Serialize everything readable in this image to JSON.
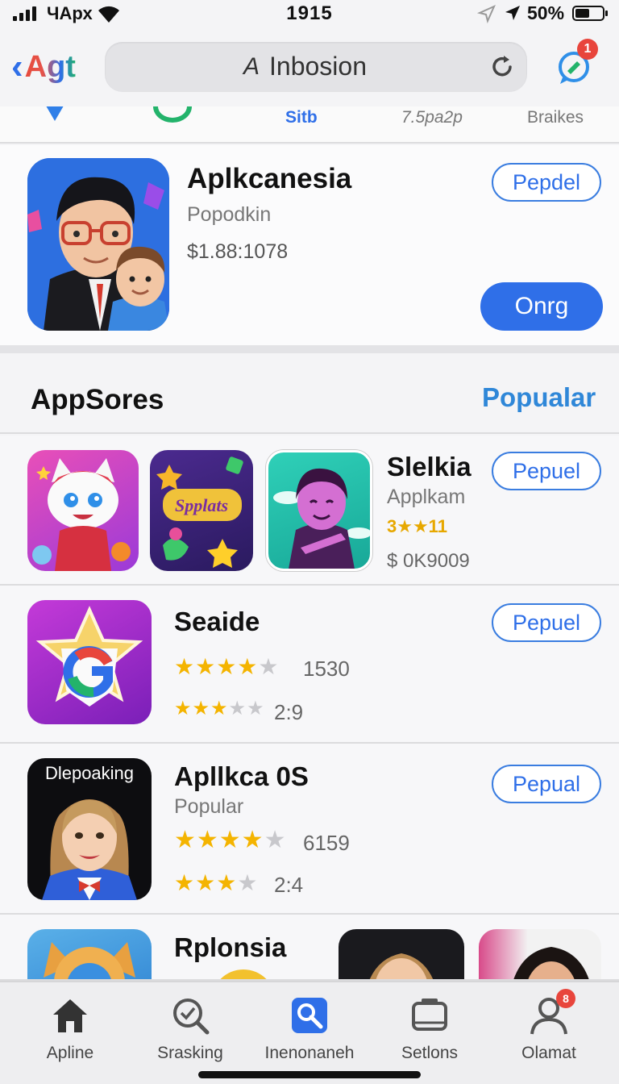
{
  "status_bar": {
    "carrier": "ЧАрх",
    "time": "1915",
    "battery": "50%"
  },
  "nav": {
    "brand": "Agt",
    "search_text": "Inbosion",
    "search_icon": "A",
    "notification_count": "1"
  },
  "categories": [
    "Sitb",
    "7.5pa2p",
    "Braikes"
  ],
  "featured": {
    "title": "Aplkcanesia",
    "subtitle": "Popodkin",
    "price": "$1.88:1078",
    "button_outline": "Pepdel",
    "button_primary": "Onrg"
  },
  "section": {
    "title": "AppSores",
    "link": "Popualar"
  },
  "rows": [
    {
      "title": "Slelkia",
      "subtitle": "Applkam",
      "rating_text": "3★★11",
      "price": "$ 0K9009",
      "button": "Pepuel"
    },
    {
      "title": "Seaide",
      "rating1": {
        "stars": 4.5,
        "count": "1530"
      },
      "rating2": {
        "stars": 2.5,
        "count": "2:9"
      },
      "button": "Pepuel"
    },
    {
      "title": "Apllkca 0S",
      "subtitle": "Popular",
      "tile_label": "Dlepoaking",
      "rating1": {
        "stars": 4,
        "count": "6159"
      },
      "rating2": {
        "stars": 3,
        "count": "2:4"
      },
      "button": "Pepual"
    },
    {
      "title": "Rplonsia"
    }
  ],
  "tile_text": {
    "splats": "Spplats"
  },
  "tabs": [
    {
      "label": "Apline",
      "icon": "home-icon"
    },
    {
      "label": "Sraskіng",
      "icon": "search-icon"
    },
    {
      "label": "Inenonaneh",
      "icon": "apps-icon"
    },
    {
      "label": "Setlons",
      "icon": "settings-icon"
    },
    {
      "label": "Olamat",
      "icon": "profile-icon",
      "badge": "8"
    }
  ],
  "colors": {
    "accent": "#2f6fe8",
    "link": "#2f87d8",
    "star": "#f4b400",
    "badge": "#e8453c"
  }
}
